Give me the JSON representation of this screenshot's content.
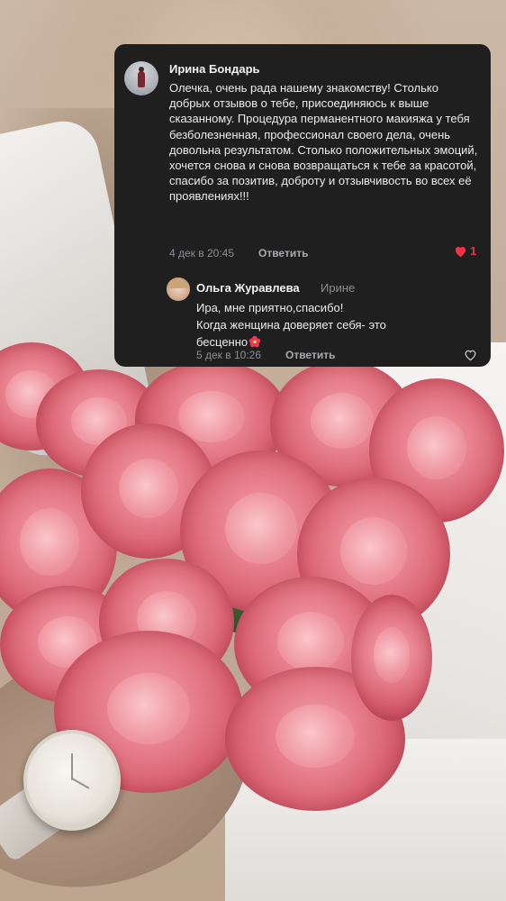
{
  "comment": {
    "author": "Ирина Бондарь",
    "text": "Олечка, очень рада нашему знакомству! Столько добрых отзывов о тебе, присоединяюсь к выше сказанному. Процедура перманентного макияжа у тебя безболезненная, профессионал своего дела, очень довольна результатом. Столько положительных эмоций, хочется снова и снова возвращаться к тебе за красотой,  спасибо за позитив, доброту и отзывчивость во всех её проявлениях!!!",
    "date": "4 дек в 20:45",
    "reply_label": "Ответить",
    "likes": "1",
    "like_icon": "heart-filled-icon",
    "like_color": "#f2324a"
  },
  "reply": {
    "author": "Ольга Журавлева",
    "to": "Ирине",
    "line1": "Ира, мне приятно,спасибо!",
    "line2": "Когда женщина доверяет себя- это",
    "line3": "бесценно",
    "emoji": "hibiscus-icon",
    "date": "5 дек в 10:26",
    "reply_label": "Ответить",
    "like_icon": "heart-outline-icon"
  }
}
